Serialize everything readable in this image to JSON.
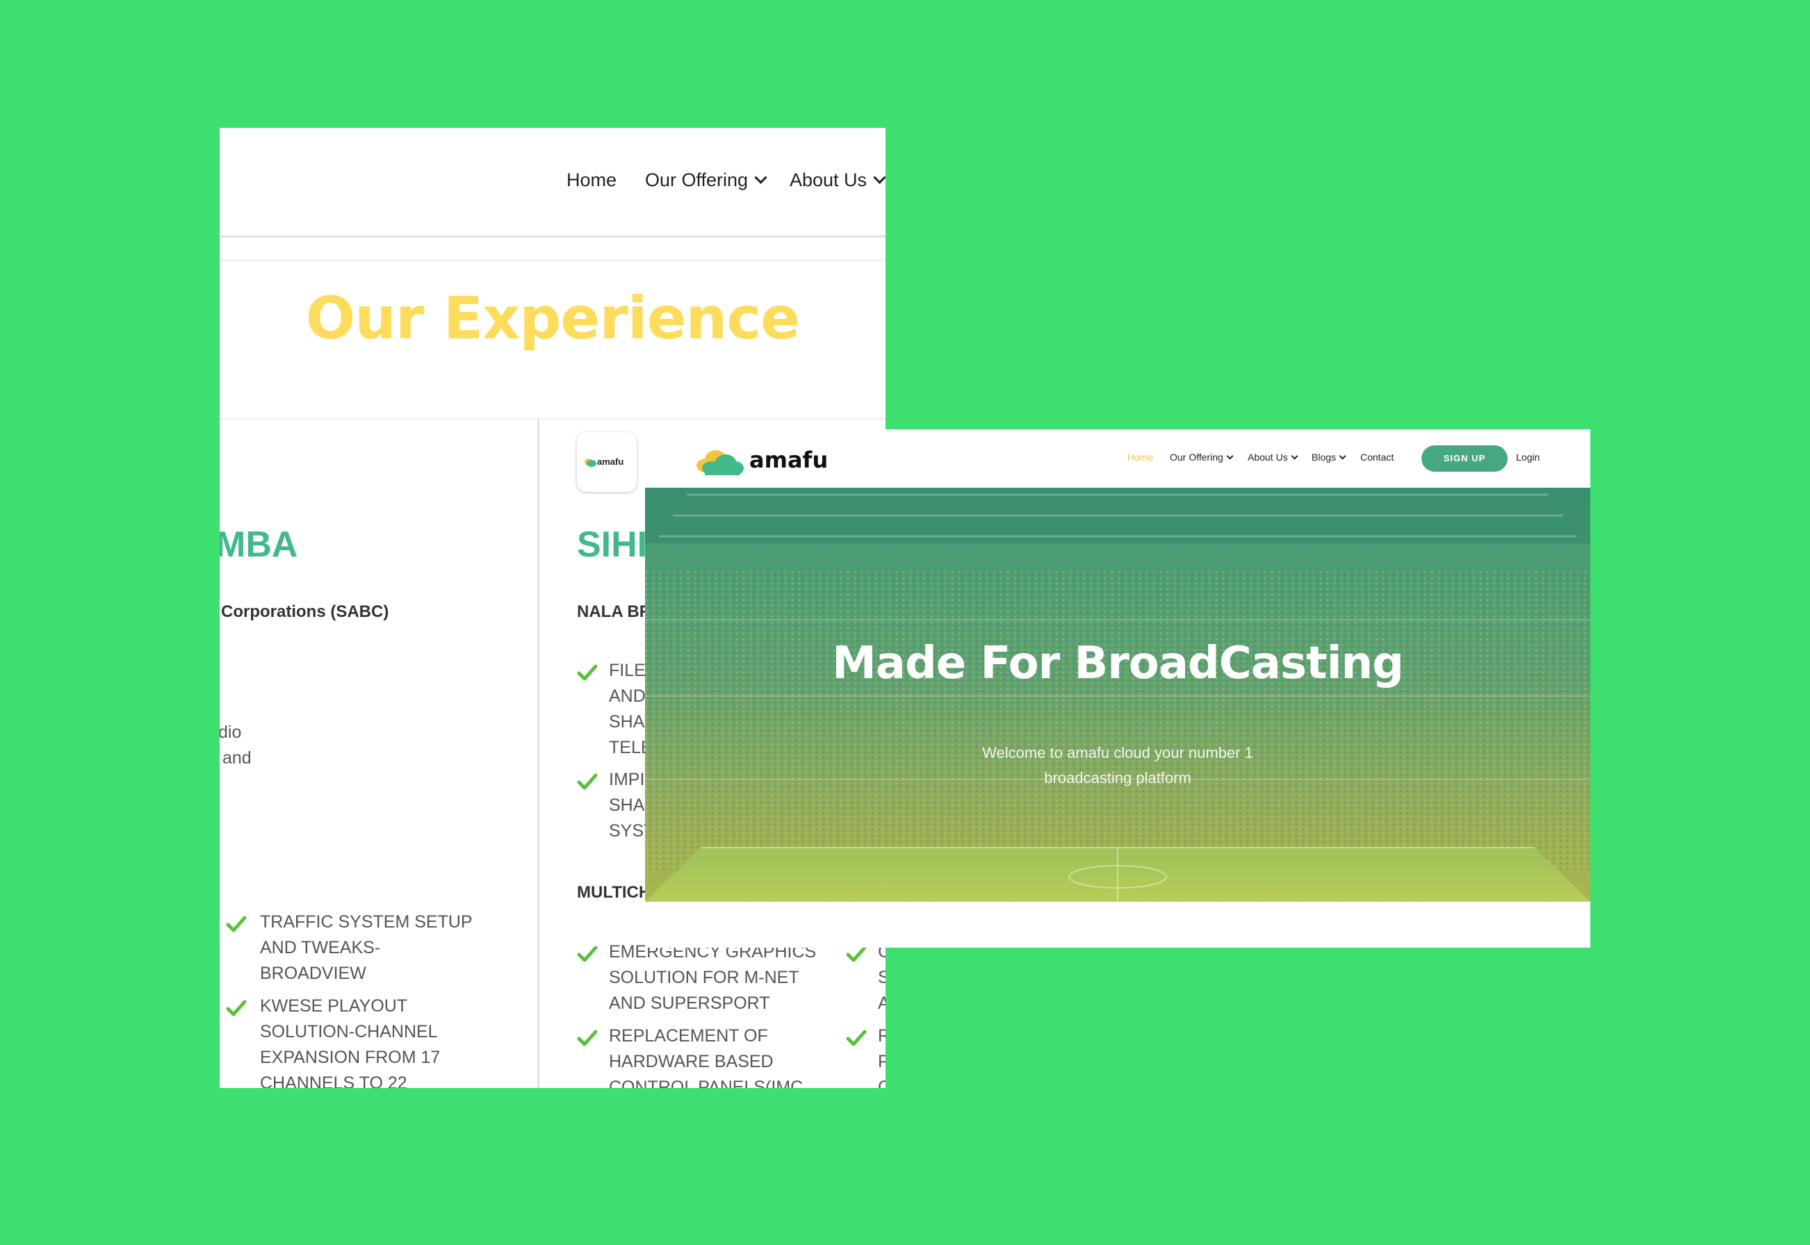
{
  "back": {
    "nav": {
      "home": "Home",
      "offering": "Our Offering",
      "about": "About Us"
    },
    "title": "Our Experience",
    "badge_brand": "amafu",
    "left": {
      "title": "MBA",
      "subtitle": "Corporations (SABC)",
      "frag1": "dio",
      "frag2": "and",
      "items": [
        [
          "TRAFFIC SYSTEM SETUP",
          "AND TWEAKS-",
          "BROADVIEW"
        ],
        [
          "KWESE PLAYOUT",
          "SOLUTION-CHANNEL",
          "EXPANSION FROM 17",
          "CHANNELS TO 22"
        ]
      ]
    },
    "mid": {
      "title": "SIHI",
      "subtitle": "NALA BR",
      "section2": "MULTICH",
      "items_a": [
        [
          "FILE",
          "AND",
          "SHA",
          "TELE"
        ],
        [
          "IMPI",
          "SHA",
          "SYST"
        ]
      ],
      "items_b": [
        [
          "EMERGENCY GRAPHICS",
          "SOLUTION FOR M-NET",
          "AND SUPERSPORT"
        ],
        [
          "REPLACEMENT OF",
          "HARDWARE BASED",
          "CONTROL PANELS(IMC"
        ]
      ],
      "items_c": [
        [
          "C",
          "S",
          "A"
        ],
        [
          "R",
          "P",
          "C"
        ]
      ]
    }
  },
  "front": {
    "brand": "amafu",
    "nav": {
      "home": "Home",
      "offering": "Our Offering",
      "about": "About Us",
      "blogs": "Blogs",
      "contact": "Contact"
    },
    "signup": "SIGN UP",
    "login": "Login",
    "hero_title": "Made For BroadCasting",
    "hero_sub_line1": "Welcome to amafu cloud your number 1",
    "hero_sub_line2": "broadcasting platform"
  },
  "colors": {
    "background": "#3ddf6e",
    "brand_teal": "#42b98a",
    "accent_yellow": "#fddc5c",
    "check_green": "#5cbf3a",
    "cloud_yellow": "#f5c43c"
  }
}
